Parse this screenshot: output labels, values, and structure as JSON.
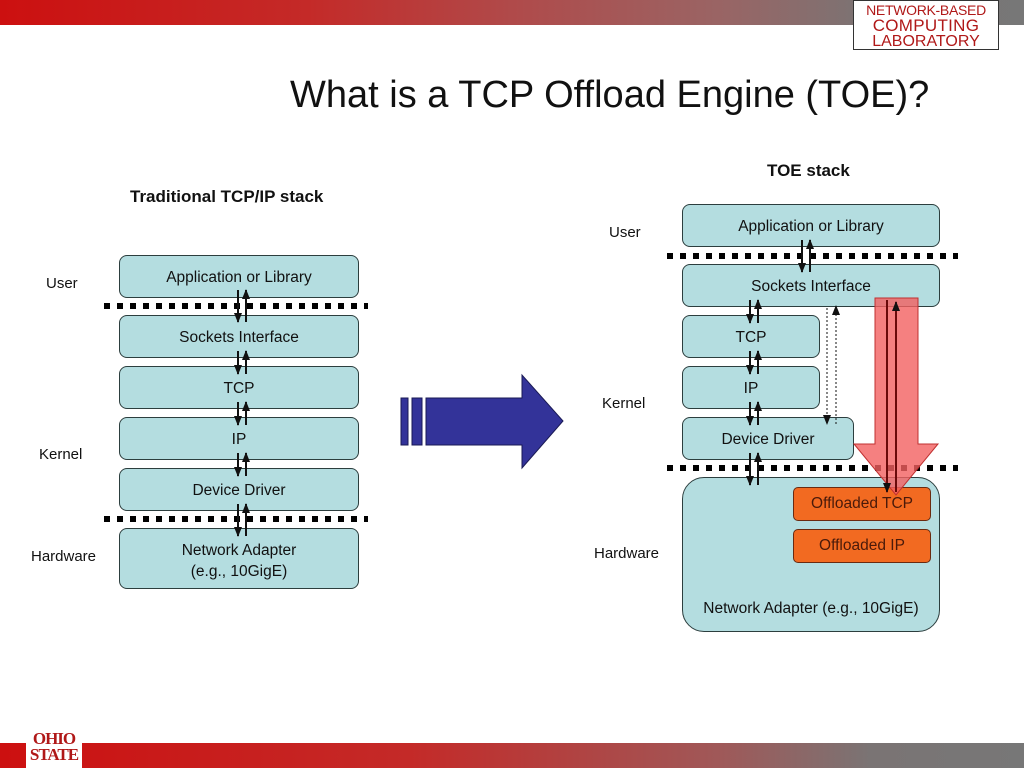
{
  "slide": {
    "title": "What is a TCP Offload Engine (TOE)?",
    "logo_top": [
      "NETWORK-BASED",
      "COMPUTING",
      "LABORATORY"
    ],
    "logo_bottom": [
      "OHIO",
      "STATE"
    ],
    "colors": {
      "banner_red": "#cc1010",
      "banner_gray": "#777777",
      "layer_fill": "#b4dde0",
      "offload_fill": "#f26a21",
      "offload_arrow": "#f47a7a",
      "transition_arrow": "#333399"
    }
  },
  "traditional": {
    "heading": "Traditional TCP/IP stack",
    "zones": {
      "user": "User",
      "kernel": "Kernel",
      "hardware": "Hardware"
    },
    "layers": [
      "Application or Library",
      "Sockets Interface",
      "TCP",
      "IP",
      "Device Driver"
    ],
    "adapter": [
      "Network Adapter",
      "(e.g., 10GigE)"
    ]
  },
  "toe": {
    "heading": "TOE stack",
    "zones": {
      "user": "User",
      "kernel": "Kernel",
      "hardware": "Hardware"
    },
    "layers": [
      "Application or Library",
      "Sockets Interface",
      "TCP",
      "IP",
      "Device Driver"
    ],
    "offloaded": [
      "Offloaded TCP",
      "Offloaded IP"
    ],
    "adapter": "Network Adapter (e.g., 10GigE)"
  }
}
